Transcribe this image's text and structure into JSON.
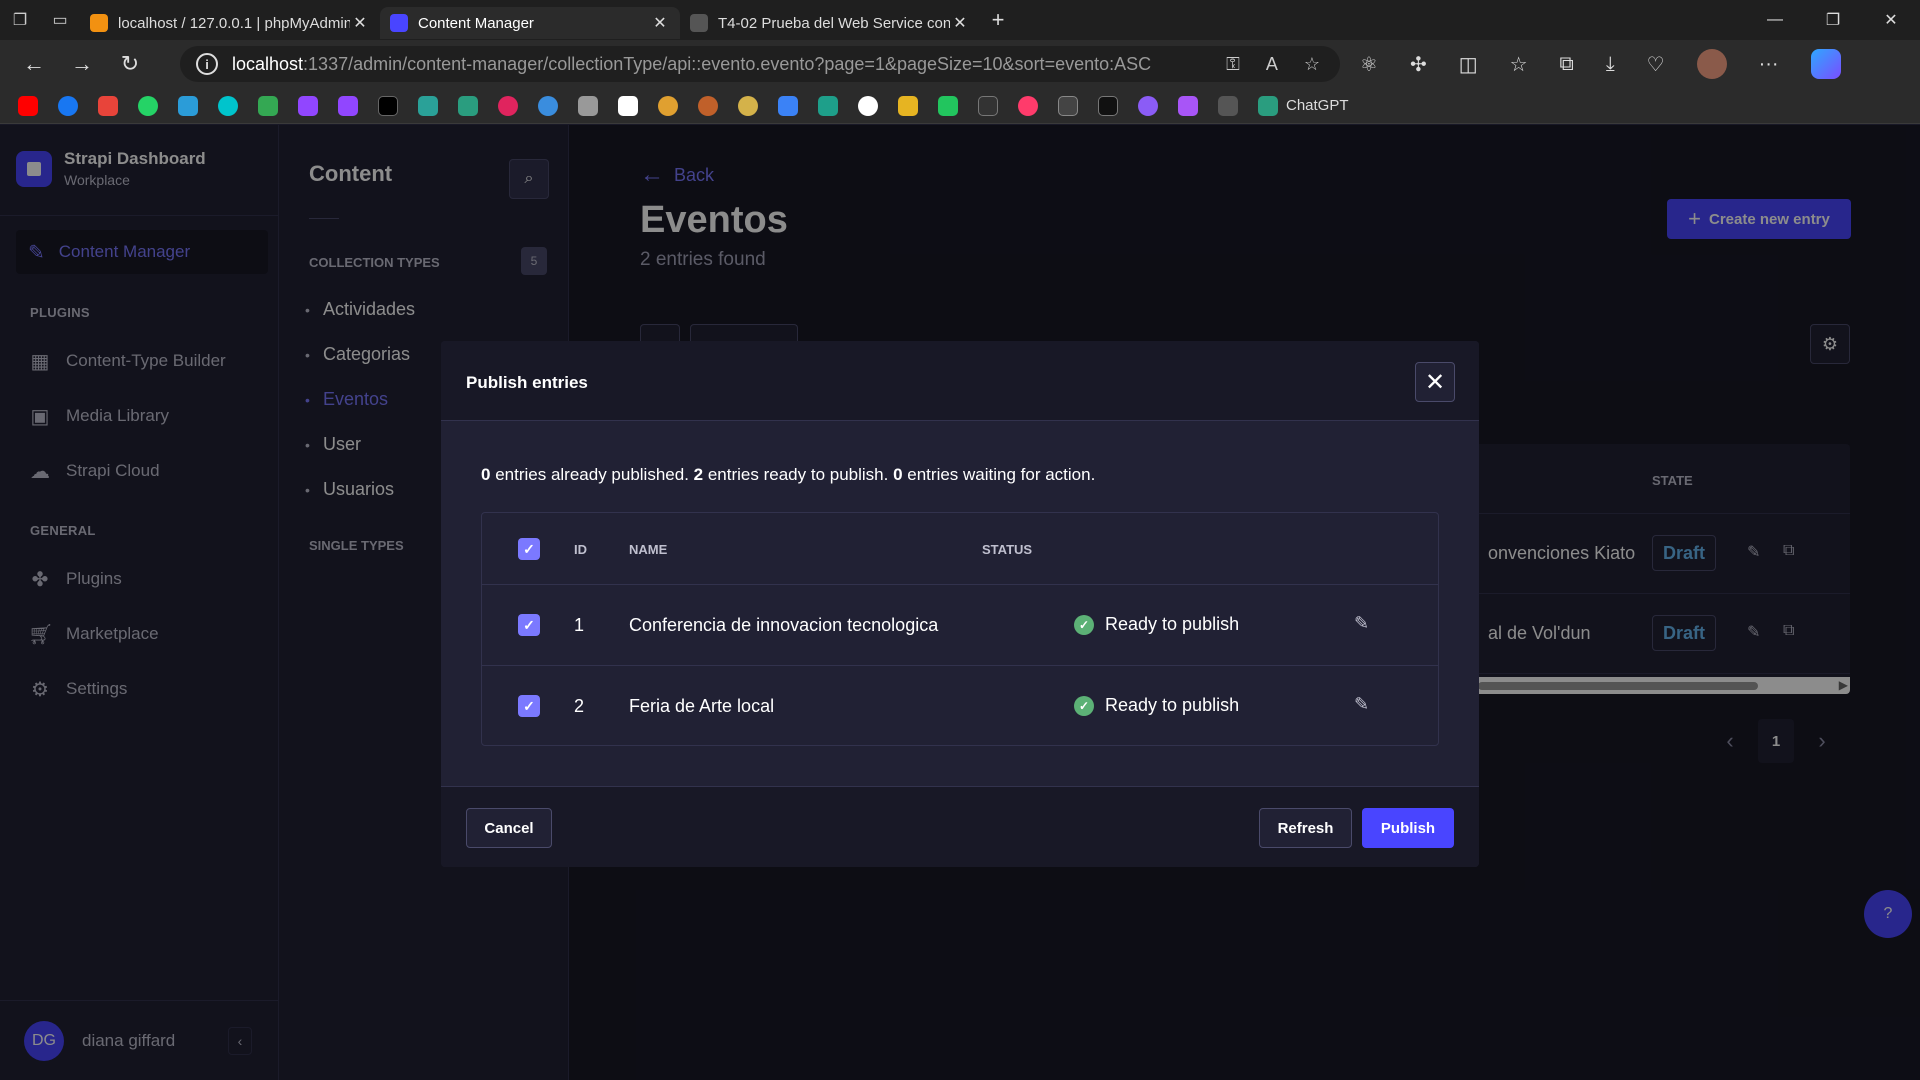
{
  "browser": {
    "tabs": [
      {
        "title": "localhost / 127.0.0.1 | phpMyAdmin",
        "active": false
      },
      {
        "title": "Content Manager",
        "active": true
      },
      {
        "title": "T4-02 Prueba del Web Service con",
        "active": false
      }
    ],
    "url_host": "localhost",
    "url_path": ":1337/admin/content-manager/collectionType/api::evento.evento?page=1&pageSize=10&sort=evento:ASC",
    "bookmark_chatgpt": "ChatGPT"
  },
  "mainnav": {
    "brand_title": "Strapi Dashboard",
    "brand_sub": "Workplace",
    "active_item": "Content Manager",
    "plugins_label": "PLUGINS",
    "plugins": [
      "Content-Type Builder",
      "Media Library",
      "Strapi Cloud"
    ],
    "general_label": "GENERAL",
    "general": [
      "Plugins",
      "Marketplace",
      "Settings"
    ],
    "user_initials": "DG",
    "user_name": "diana giffard"
  },
  "subnav": {
    "title": "Content",
    "collection_label": "COLLECTION TYPES",
    "collection_count": "5",
    "items": [
      "Actividades",
      "Categorias",
      "Eventos",
      "User",
      "Usuarios"
    ],
    "single_label": "SINGLE TYPES"
  },
  "main": {
    "back": "Back",
    "title": "Eventos",
    "subtitle": "2 entries found",
    "create_button": "Create new entry",
    "state_header": "STATE",
    "rows": [
      {
        "name_partial": "onvenciones Kiato",
        "state": "Draft"
      },
      {
        "name_partial": "al de Vol'dun",
        "state": "Draft"
      }
    ],
    "current_page": "1"
  },
  "modal": {
    "title": "Publish entries",
    "summary": {
      "published_count": "0",
      "published_text": " entries already published. ",
      "ready_count": "2",
      "ready_text": " entries ready to publish. ",
      "waiting_count": "0",
      "waiting_text": " entries waiting for action."
    },
    "headers": {
      "id": "ID",
      "name": "NAME",
      "status": "STATUS"
    },
    "entries": [
      {
        "id": "1",
        "name": "Conferencia de innovacion tecnologica",
        "status": "Ready to publish",
        "checked": true
      },
      {
        "id": "2",
        "name": "Feria de Arte local",
        "status": "Ready to publish",
        "checked": true
      }
    ],
    "cancel": "Cancel",
    "refresh": "Refresh",
    "publish": "Publish"
  },
  "colors": {
    "primary": "#4945ff",
    "primary_light": "#7b79ff",
    "success": "#5cb176",
    "draft": "#66b7f1"
  }
}
